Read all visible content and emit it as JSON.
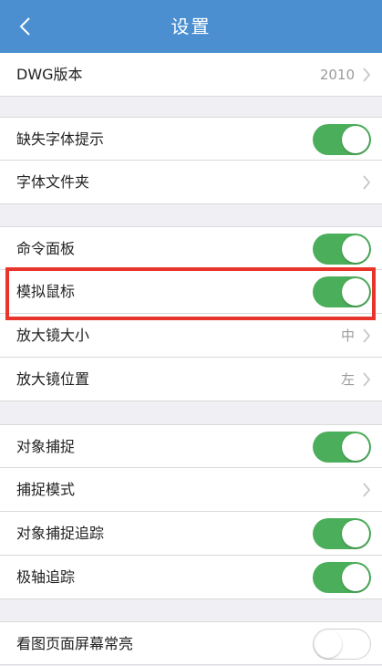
{
  "header": {
    "back_icon": "chevron-left-icon",
    "title": "设置"
  },
  "colors": {
    "header_bg": "#4b8fd1",
    "toggle_on": "#4bae5a",
    "highlight": "#e8342a"
  },
  "rows": [
    {
      "label": "DWG版本",
      "type": "value",
      "value": "2010"
    },
    {
      "label": "缺失字体提示",
      "type": "toggle",
      "on": true
    },
    {
      "label": "字体文件夹",
      "type": "link"
    },
    {
      "label": "命令面板",
      "type": "toggle",
      "on": true
    },
    {
      "label": "模拟鼠标",
      "type": "toggle",
      "on": true
    },
    {
      "label": "放大镜大小",
      "type": "value",
      "value": "中"
    },
    {
      "label": "放大镜位置",
      "type": "value",
      "value": "左"
    },
    {
      "label": "对象捕捉",
      "type": "toggle",
      "on": true
    },
    {
      "label": "捕捉模式",
      "type": "link"
    },
    {
      "label": "对象捕捉追踪",
      "type": "toggle",
      "on": true
    },
    {
      "label": "极轴追踪",
      "type": "toggle",
      "on": true
    },
    {
      "label": "看图页面屏幕常亮",
      "type": "toggle",
      "on": false
    }
  ]
}
